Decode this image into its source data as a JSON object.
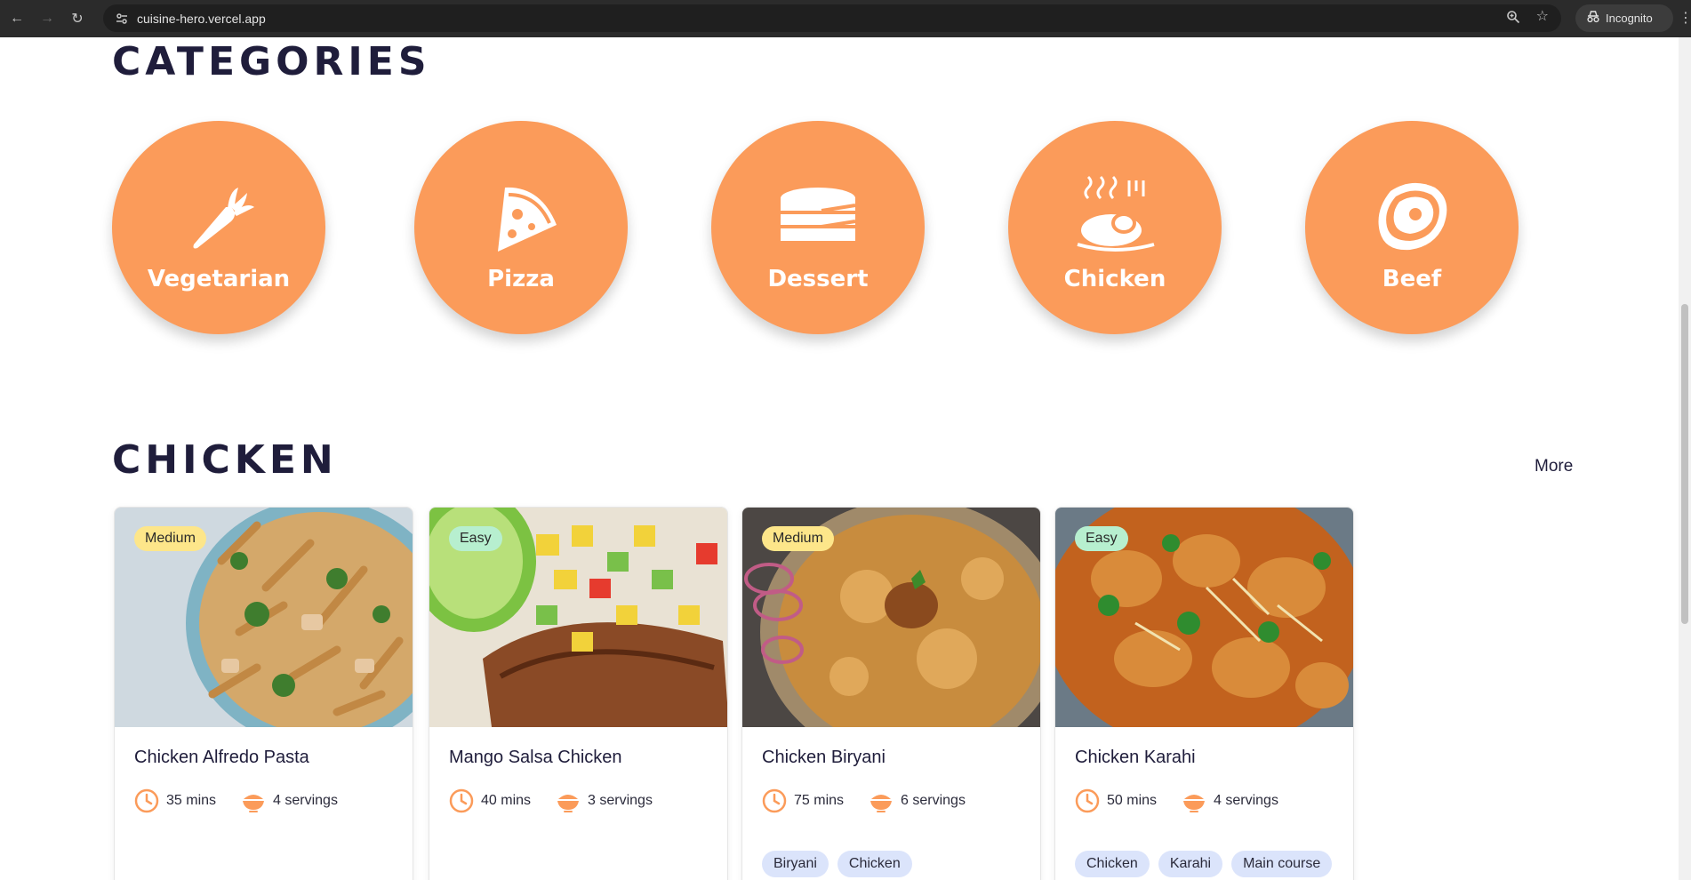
{
  "browser": {
    "url": "cuisine-hero.vercel.app",
    "profile_label": "Incognito"
  },
  "categories": {
    "heading": "CATEGORIES",
    "items": [
      {
        "label": "Vegetarian",
        "icon": "carrot-icon"
      },
      {
        "label": "Pizza",
        "icon": "pizza-slice-icon"
      },
      {
        "label": "Dessert",
        "icon": "cake-icon"
      },
      {
        "label": "Chicken",
        "icon": "roast-chicken-icon"
      },
      {
        "label": "Beef",
        "icon": "steak-icon"
      }
    ]
  },
  "chicken": {
    "heading": "CHICKEN",
    "more_label": "More",
    "recipes": [
      {
        "title": "Chicken Alfredo Pasta",
        "difficulty": "Medium",
        "time": "35 mins",
        "servings": "4 servings",
        "tags": []
      },
      {
        "title": "Mango Salsa Chicken",
        "difficulty": "Easy",
        "time": "40 mins",
        "servings": "3 servings",
        "tags": []
      },
      {
        "title": "Chicken Biryani",
        "difficulty": "Medium",
        "time": "75 mins",
        "servings": "6 servings",
        "tags": [
          "Biryani",
          "Chicken"
        ]
      },
      {
        "title": "Chicken Karahi",
        "difficulty": "Easy",
        "time": "50 mins",
        "servings": "4 servings",
        "tags": [
          "Chicken",
          "Karahi",
          "Main course"
        ]
      }
    ]
  },
  "colors": {
    "accent": "#fb9b5a",
    "heading": "#1f1d3b",
    "badge_medium": "#fde68a",
    "badge_easy": "#b7efcf",
    "tag_bg": "#dbe4fb"
  }
}
